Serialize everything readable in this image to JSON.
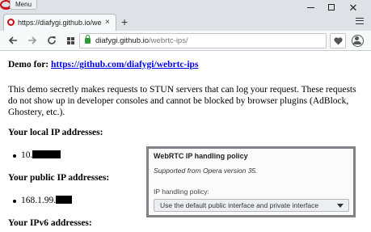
{
  "browser": {
    "menu_label": "Menu",
    "tab_title": "https://diafygi.github.io/we",
    "tab_close": "×",
    "new_tab": "+",
    "window_close": "✕",
    "url_host": "diafygi.github.io",
    "url_path": "/webrtc-ips/",
    "accent_color": "#cc0f16",
    "secure_color": "#2f9a36"
  },
  "page": {
    "demo_label": "Demo for:",
    "demo_link": "https://github.com/diafygi/webrtc-ips",
    "description": "This demo secretly makes requests to STUN servers that can log your request. These requests do not show up in developer consoles and cannot be blocked by browser plugins (AdBlock, Ghostery, etc.).",
    "local_heading": "Your local IP addresses:",
    "local_ip_prefix": "10.",
    "public_heading": "Your public IP addresses:",
    "public_ip_prefix": "168.1.99.",
    "ipv6_heading": "Your IPv6 addresses:"
  },
  "dialog": {
    "title": "WebRTC IP handling policy",
    "subtitle": "Supported from Opera version 35.",
    "field_label": "IP handling policy:",
    "selected_option": "Use the default public interface and private interface"
  }
}
